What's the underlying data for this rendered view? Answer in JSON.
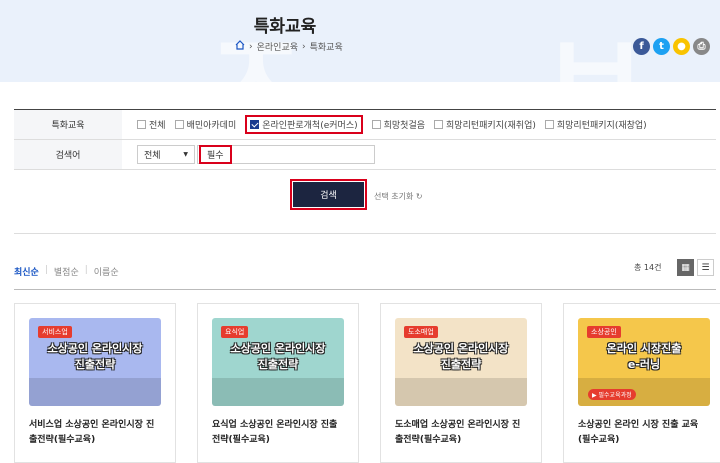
{
  "header": {
    "title": "특화교육",
    "breadcrumb": [
      "온라인교육",
      "특화교육"
    ],
    "social": [
      {
        "icon": "facebook-icon",
        "glyph": "f",
        "color": "#3b5998"
      },
      {
        "icon": "twitter-icon",
        "glyph": "t",
        "color": "#1da1f2"
      },
      {
        "icon": "kakao-icon",
        "glyph": "●",
        "color": "#f9c300"
      },
      {
        "icon": "print-icon",
        "glyph": "⎙",
        "color": "#888888"
      }
    ]
  },
  "filter": {
    "category_label": "특화교육",
    "options": [
      {
        "label": "전체",
        "checked": false
      },
      {
        "label": "배민아카데미",
        "checked": false
      },
      {
        "label": "온라인판로개척(e커머스)",
        "checked": true
      },
      {
        "label": "희망첫걸음",
        "checked": false
      },
      {
        "label": "희망리턴패키지(재취업)",
        "checked": false
      },
      {
        "label": "희망리턴패키지(재창업)",
        "checked": false
      }
    ],
    "search_label": "검색어",
    "search_scope": "전체",
    "search_value": "필수",
    "search_button": "검색",
    "reset_label": "선택 초기화"
  },
  "listing": {
    "sort": [
      "최신순",
      "별점순",
      "이름순"
    ],
    "total": "총 14건",
    "cards": [
      {
        "tag": "서비스업",
        "line1": "소상공인 온라인시장",
        "line2": "진출전략",
        "bg": "#a9b8ef",
        "title": "서비스업 소상공인 온라인시장 진출전략(필수교육)"
      },
      {
        "tag": "요식업",
        "line1": "소상공인 온라인시장",
        "line2": "진출전략",
        "bg": "#9fd6cf",
        "title": "요식업 소상공인 온라인시장 진출전략(필수교육)"
      },
      {
        "tag": "도소매업",
        "line1": "소상공인 온라인시장",
        "line2": "진출전략",
        "bg": "#f3e3c7",
        "title": "도소매업 소상공인 온라인시장 진출전략(필수교육)"
      },
      {
        "tag": "소상공인",
        "line1": "온라인 시장진출",
        "line2": "e-러닝",
        "bg": "#f5c74b",
        "pill": "▶ 필수교육과정",
        "title": "소상공인 온라인 시장 진출 교육(필수교육)"
      }
    ]
  }
}
